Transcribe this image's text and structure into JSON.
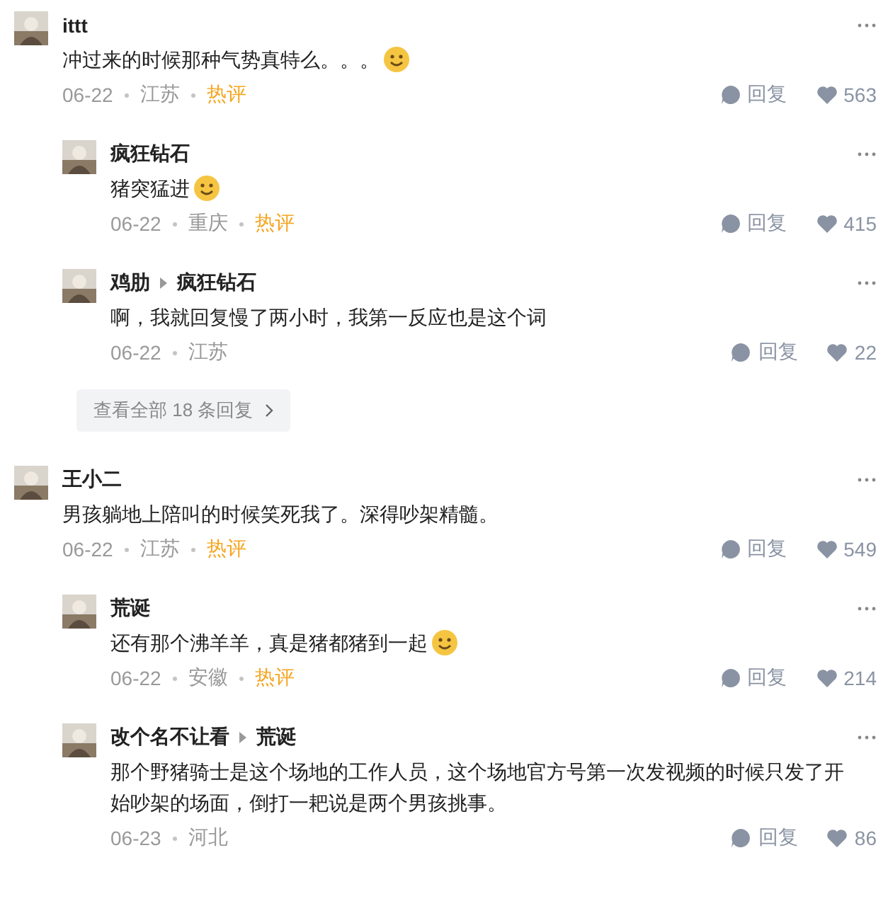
{
  "threads": [
    {
      "comment": {
        "author": "ittt",
        "text": "冲过来的时候那种气势真特么。。。",
        "emoji": true,
        "date": "06-22",
        "location": "江苏",
        "hot_label": "热评",
        "reply_label": "回复",
        "likes": "563"
      },
      "replies": [
        {
          "author": "疯狂钻石",
          "text": "猪突猛进",
          "emoji": true,
          "date": "06-22",
          "location": "重庆",
          "hot_label": "热评",
          "reply_label": "回复",
          "likes": "415"
        },
        {
          "author": "鸡肋",
          "reply_to": "疯狂钻石",
          "text": "啊，我就回复慢了两小时，我第一反应也是这个词",
          "date": "06-22",
          "location": "江苏",
          "reply_label": "回复",
          "likes": "22"
        }
      ],
      "more_label": "查看全部 18 条回复"
    },
    {
      "comment": {
        "author": "王小二",
        "text": "男孩躺地上陪叫的时候笑死我了。深得吵架精髓。",
        "date": "06-22",
        "location": "江苏",
        "hot_label": "热评",
        "reply_label": "回复",
        "likes": "549"
      },
      "replies": [
        {
          "author": "荒诞",
          "text": "还有那个沸羊羊，真是猪都猪到一起",
          "emoji": true,
          "date": "06-22",
          "location": "安徽",
          "hot_label": "热评",
          "reply_label": "回复",
          "likes": "214"
        },
        {
          "author": "改个名不让看",
          "reply_to": "荒诞",
          "text": "那个野猪骑士是这个场地的工作人员，这个场地官方号第一次发视频的时候只发了开始吵架的场面，倒打一耙说是两个男孩挑事。",
          "date": "06-23",
          "location": "河北",
          "reply_label": "回复",
          "likes": "86"
        }
      ]
    }
  ]
}
